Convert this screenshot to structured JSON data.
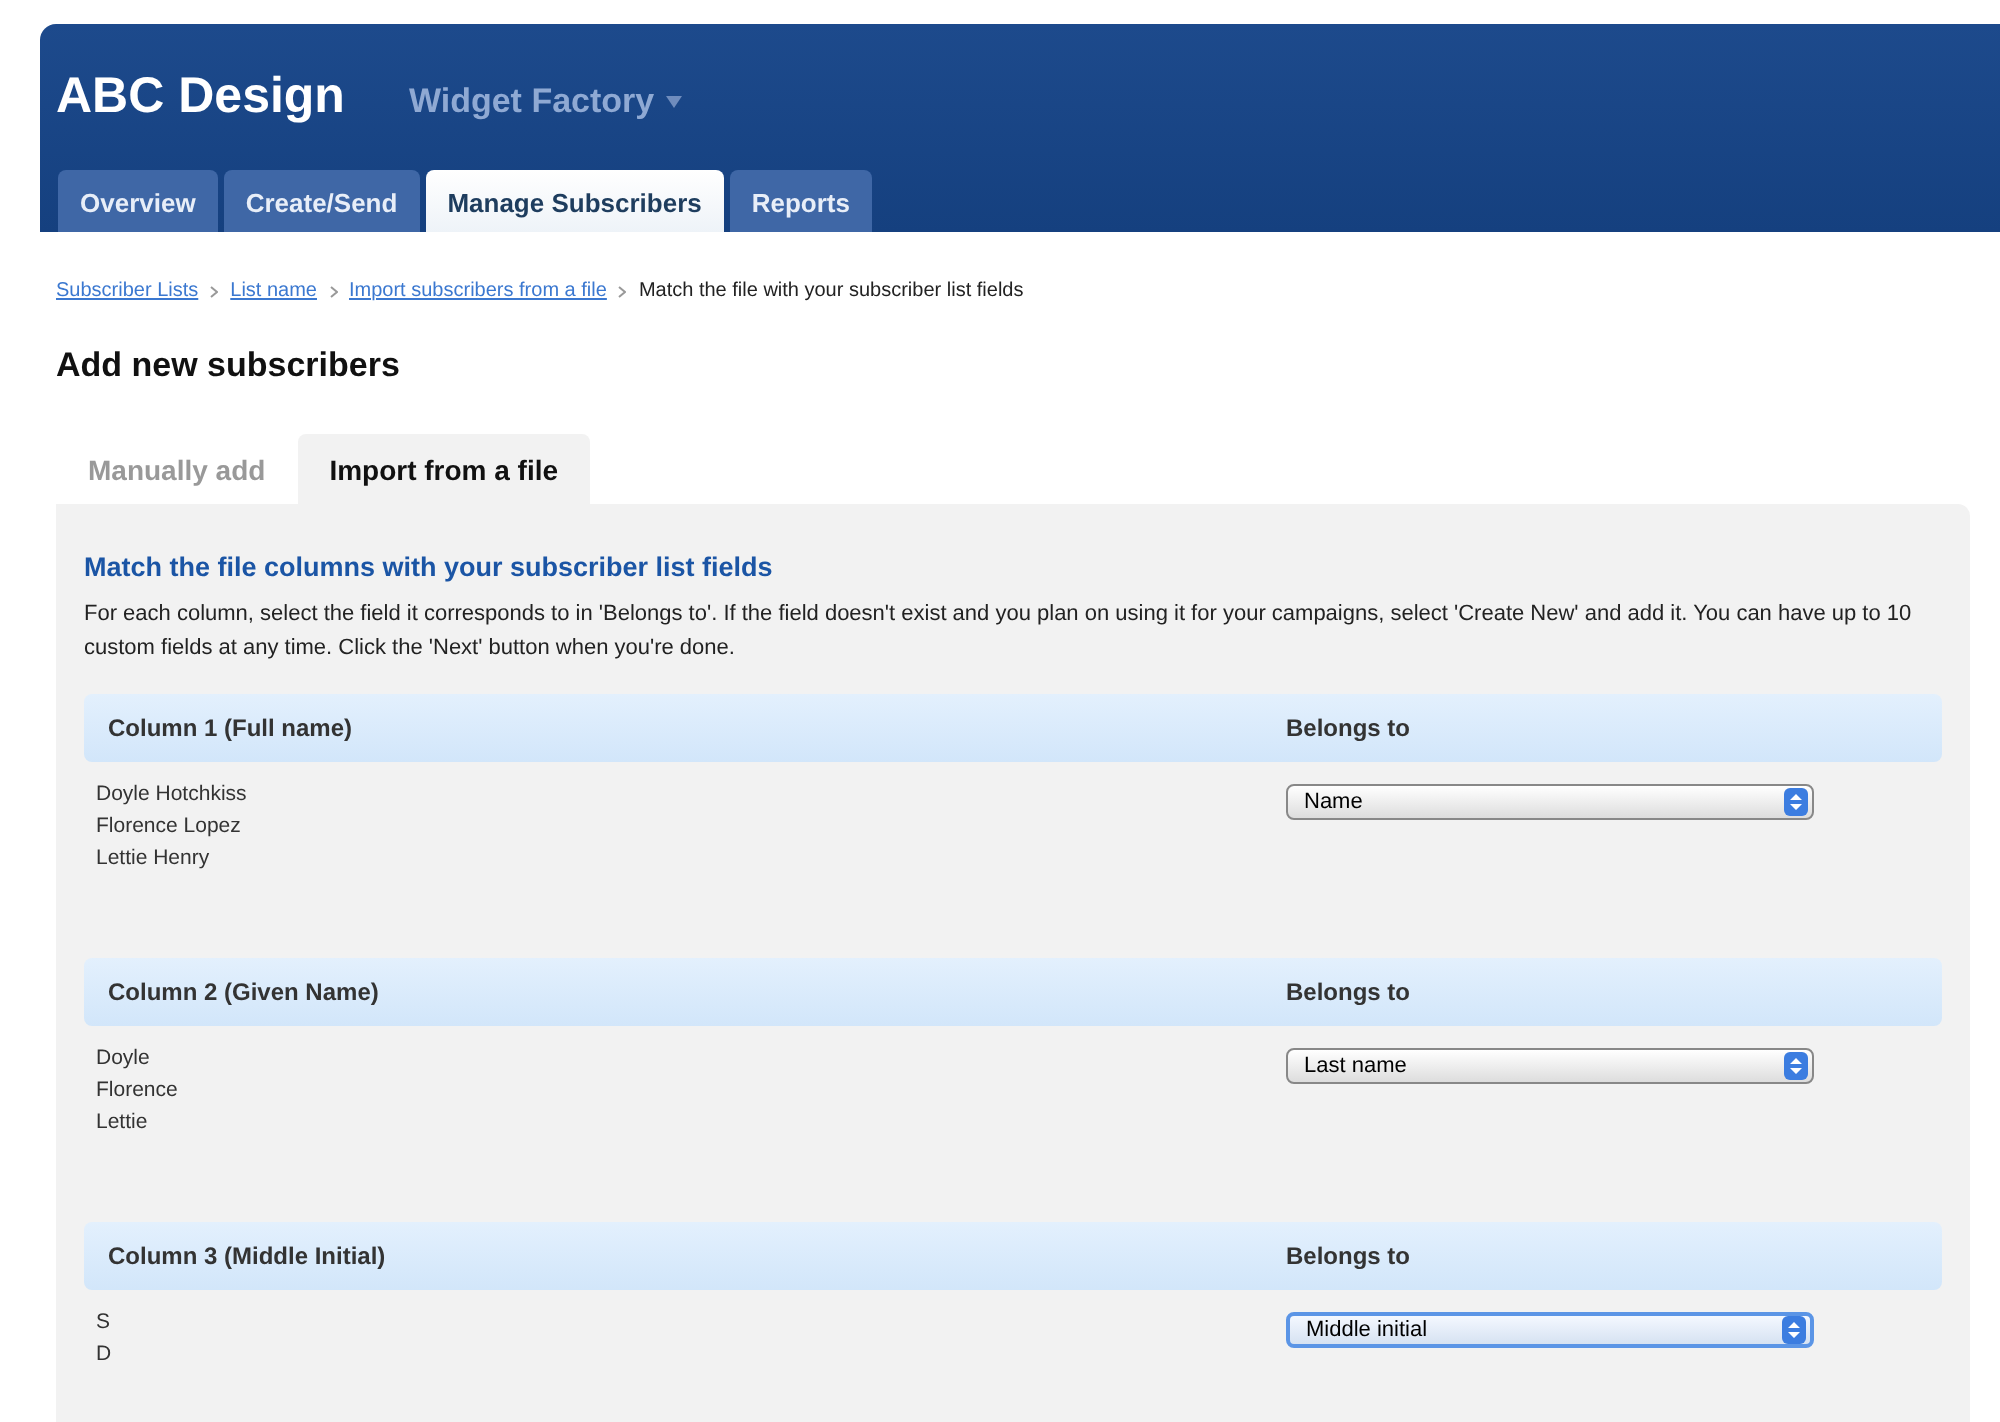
{
  "header": {
    "brand": "ABC Design",
    "account": "Widget Factory"
  },
  "nav_tabs": [
    {
      "label": "Overview",
      "selected": false
    },
    {
      "label": "Create/Send",
      "selected": false
    },
    {
      "label": "Manage Subscribers",
      "selected": true
    },
    {
      "label": "Reports",
      "selected": false
    }
  ],
  "breadcrumb": {
    "links": [
      "Subscriber Lists",
      "List name",
      "Import subscribers from a file"
    ],
    "current": "Match the file with your subscriber list fields"
  },
  "page_title": "Add new subscribers",
  "sub_tabs": [
    {
      "label": "Manually add",
      "selected": false
    },
    {
      "label": "Import from a file",
      "selected": true
    }
  ],
  "panel": {
    "title": "Match the file columns with your subscriber list fields",
    "description": "For each column, select the field it corresponds to in 'Belongs to'. If the field doesn't exist and you plan on using it for your campaigns, select 'Create New' and add it. You can have up to 10 custom fields at any time. Click the 'Next' button when you're done.",
    "columns": [
      {
        "heading": "Column 1 (Full name)",
        "belongs_label": "Belongs to",
        "samples": [
          "Doyle Hotchkiss",
          "Florence Lopez",
          "Lettie Henry"
        ],
        "field": "Name",
        "focused": false
      },
      {
        "heading": "Column 2 (Given Name)",
        "belongs_label": "Belongs to",
        "samples": [
          "Doyle",
          "Florence",
          "Lettie"
        ],
        "field": "Last name",
        "focused": false
      },
      {
        "heading": "Column 3 (Middle Initial)",
        "belongs_label": "Belongs to",
        "samples": [
          "S",
          "D"
        ],
        "field": "Middle initial",
        "focused": true
      }
    ]
  }
}
